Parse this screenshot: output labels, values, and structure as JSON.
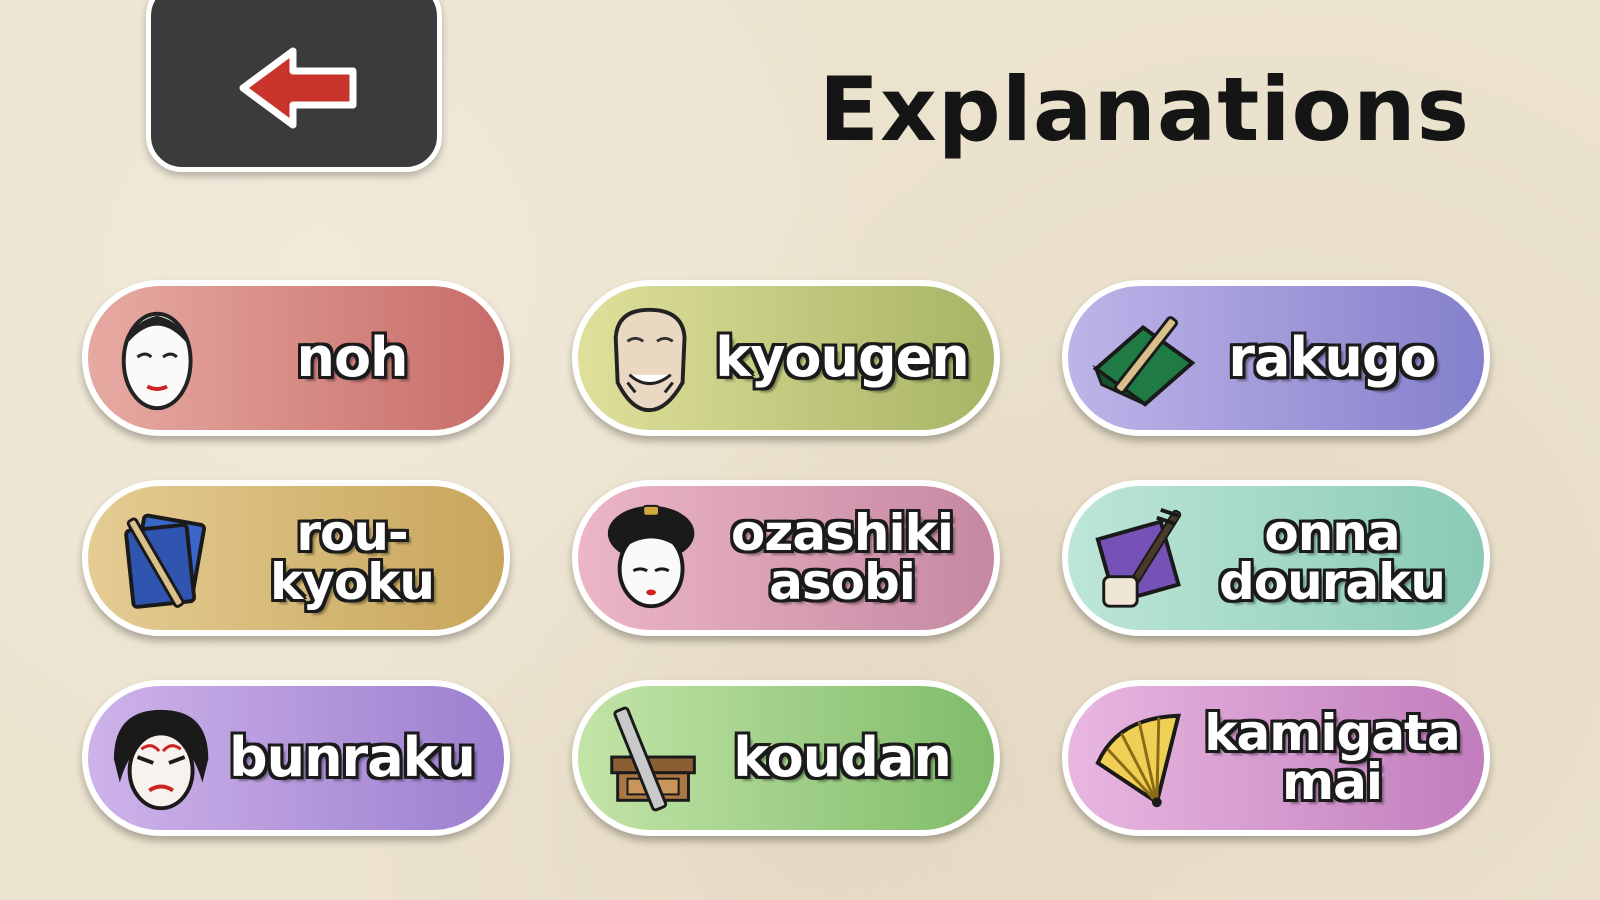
{
  "header": {
    "title": "Explanations",
    "back_icon": "red-left-arrow-icon"
  },
  "topics": [
    {
      "id": "noh",
      "label": "noh",
      "icon": "noh-mask-icon",
      "color_from": "#e6aaa2",
      "color_to": "#c86d69"
    },
    {
      "id": "kyougen",
      "label": "kyougen",
      "icon": "kyougen-mask-icon",
      "color_from": "#dfe09b",
      "color_to": "#a8b465"
    },
    {
      "id": "rakugo",
      "label": "rakugo",
      "icon": "fan-cushion-icon",
      "color_from": "#bdb4e8",
      "color_to": "#8480cc"
    },
    {
      "id": "roukyoku",
      "label": "rou-\nkyoku",
      "icon": "book-fan-icon",
      "color_from": "#e4cc93",
      "color_to": "#c8a65b"
    },
    {
      "id": "ozashiki-asobi",
      "label": "ozashiki\nasobi",
      "icon": "geisha-face-icon",
      "color_from": "#ecb6c6",
      "color_to": "#c588a2"
    },
    {
      "id": "onna-douraku",
      "label": "onna\ndouraku",
      "icon": "shamisen-icon",
      "color_from": "#bde6d8",
      "color_to": "#8acab7"
    },
    {
      "id": "bunraku",
      "label": "bunraku",
      "icon": "kabuki-face-icon",
      "color_from": "#ceb3ea",
      "color_to": "#9c7fcf"
    },
    {
      "id": "koudan",
      "label": "koudan",
      "icon": "desk-fan-icon",
      "color_from": "#c3e4a7",
      "color_to": "#7fbc6a"
    },
    {
      "id": "kamigata-mai",
      "label": "kamigata\nmai",
      "icon": "folding-fan-icon",
      "color_from": "#e8b7e0",
      "color_to": "#c17dbd"
    }
  ]
}
